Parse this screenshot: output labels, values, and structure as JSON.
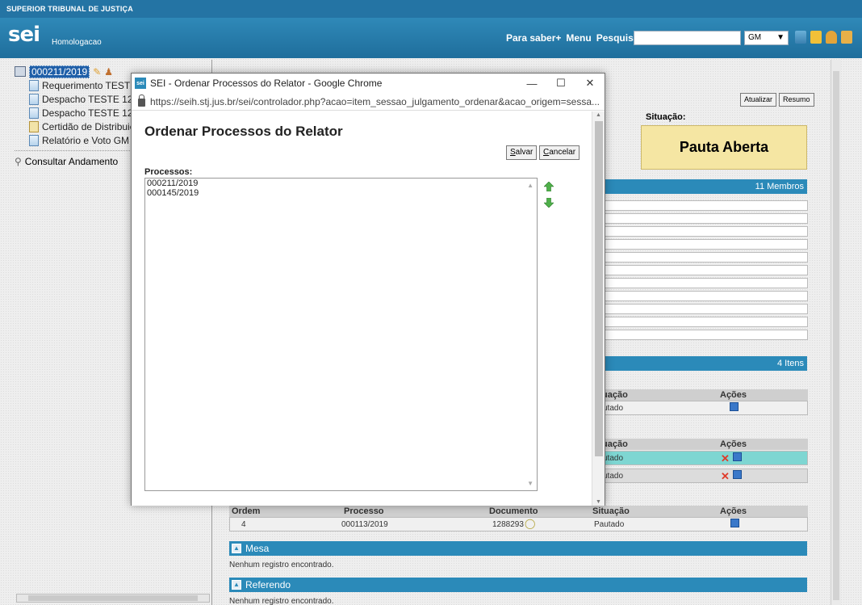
{
  "header": {
    "org_name": "SUPERIOR TRIBUNAL DE JUSTIÇA",
    "logo": "sei",
    "environment": "Homologacao",
    "links": {
      "para_saber": "Para saber+",
      "menu": "Menu",
      "pesquisa": "Pesquisa"
    },
    "search_value": "",
    "unit_select": "GM",
    "icons": [
      "list-icon",
      "n-icon",
      "user-icon",
      "wrench-icon"
    ]
  },
  "tree": {
    "process_number": "000211/2019",
    "items": [
      {
        "icon": "document-icon",
        "label": "Requerimento TESTE"
      },
      {
        "icon": "document-icon",
        "label": "Despacho TESTE 12"
      },
      {
        "icon": "document-icon",
        "label": "Despacho TESTE 12"
      },
      {
        "icon": "certificate-icon",
        "label": "Certidão de Distribuição"
      },
      {
        "icon": "document-icon",
        "label": "Relatório e Voto GM"
      }
    ],
    "consult_label": "Consultar Andamento"
  },
  "main": {
    "buttons": {
      "atualizar": "Atualizar",
      "resumo": "Resumo"
    },
    "situacao_label": "Situação:",
    "situacao_value": "Pauta Aberta",
    "membros_label": "11 Membros",
    "itens_label": "4 Itens",
    "table1": {
      "headers": {
        "situacao": "uação",
        "acoes": "Ações"
      },
      "rows": [
        {
          "situacao": "utado"
        }
      ]
    },
    "table2": {
      "headers": {
        "situacao": "uação",
        "acoes": "Ações"
      },
      "rows": [
        {
          "situacao": "utado"
        },
        {
          "situacao": "utado"
        }
      ]
    },
    "table3": {
      "headers": {
        "ordem": "Ordem",
        "processo": "Processo",
        "documento": "Documento",
        "situacao": "Situação",
        "acoes": "Ações"
      },
      "rows": [
        {
          "ordem": "4",
          "processo": "000113/2019",
          "documento": "1288293",
          "situacao": "Pautado"
        }
      ]
    },
    "mesa_title": "Mesa",
    "mesa_empty": "Nenhum registro encontrado.",
    "referendo_title": "Referendo",
    "referendo_empty": "Nenhum registro encontrado."
  },
  "popup": {
    "window_title": "SEI - Ordenar Processos do Relator - Google Chrome",
    "url": "https://seih.stj.jus.br/sei/controlador.php?acao=item_sessao_julgamento_ordenar&acao_origem=sessa...",
    "heading": "Ordenar Processos do Relator",
    "salvar_rest": "alvar",
    "salvar_key": "S",
    "cancelar_rest": "ancelar",
    "cancelar_key": "C",
    "processos_label": "Processos:",
    "processos": [
      "000211/2019",
      "000145/2019"
    ]
  },
  "colors": {
    "header_blue": "#2474a4",
    "section_blue": "#2b8ab9",
    "pauta_yellow": "#f5e6a3",
    "teal_row": "#7ed6d2"
  }
}
